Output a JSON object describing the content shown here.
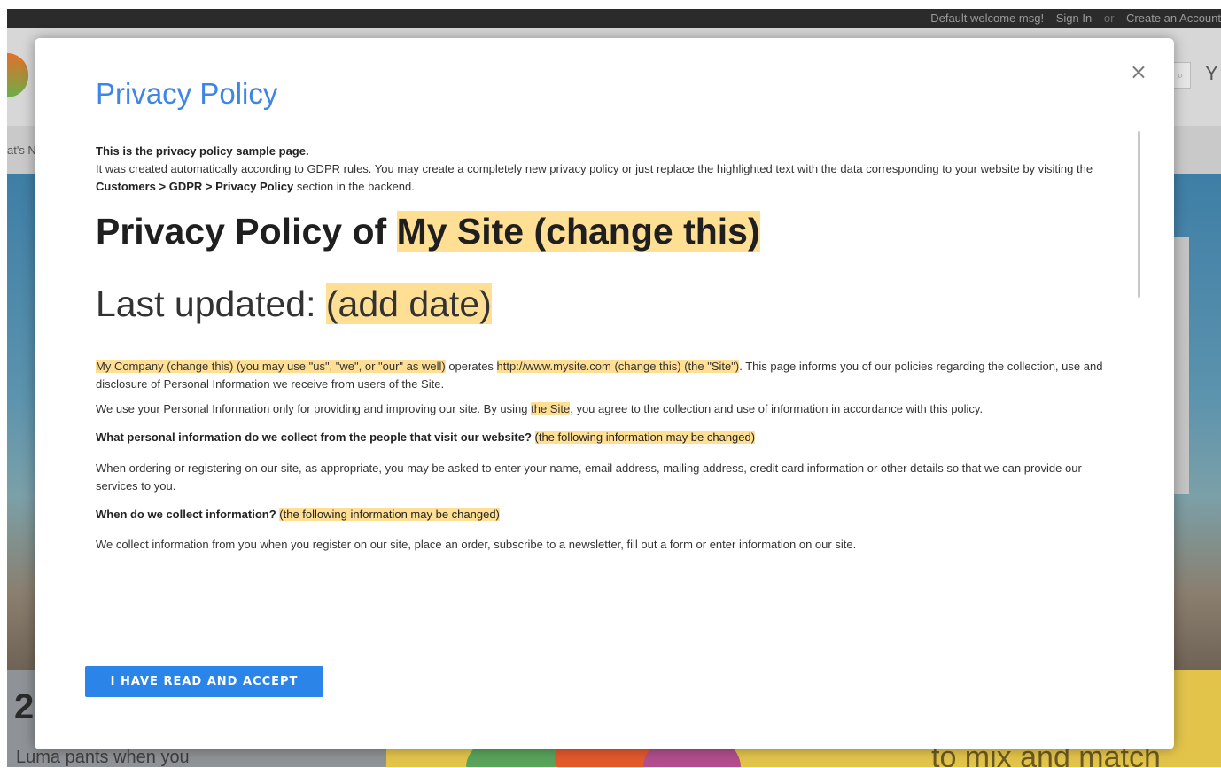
{
  "background_page": {
    "header_links": [
      "Default welcome msg!",
      "Sign In",
      "or",
      "Create an Account"
    ],
    "nav_partial": "at's N",
    "promo_left_big": "2",
    "promo_left_small": "Luma pants when you",
    "promo_right_text": "to mix and match"
  },
  "modal": {
    "title": "Privacy Policy",
    "close_icon": "×",
    "intro_bold": "This is the privacy policy sample page.",
    "intro_text_1": "It was created automatically according to GDPR rules. You may create a completely new privacy policy or just replace the highlighted text with the data corresponding to your website by visiting the ",
    "intro_text_path": "Customers > GDPR > Privacy Policy",
    "intro_text_2": " section in the backend.",
    "heading_prefix": "Privacy Policy of ",
    "heading_highlight": "My Site (change this)",
    "updated_prefix": "Last updated: ",
    "updated_highlight": "(add date)",
    "p1_hl1": "My Company (change this) (you may use \"us\", \"we\", or \"our\" as well)",
    "p1_mid": " operates ",
    "p1_hl2": "http://www.mysite.com (change this) (the \"Site\")",
    "p1_end": ". This page informs you of our policies regarding the collection, use and disclosure of Personal Information we receive from users of the Site.",
    "p2_start": "We use your Personal Information only for providing and improving our site. By using ",
    "p2_hl": "the Site",
    "p2_end": ", you agree to the collection and use of information in accordance with this policy.",
    "q1": "What personal information do we collect from the people that visit our website? ",
    "q1_hl": "(the following information may be changed)",
    "p3": "When ordering or registering on our site, as appropriate, you may be asked to enter your name, email address, mailing address, credit card information or other details so that we can provide our services to you.",
    "q2": "When do we collect information? ",
    "q2_hl": "(the following information may be changed)",
    "p4": "We collect information from you when you register on our site, place an order, subscribe to a newsletter, fill out a form or enter information on our site.",
    "accept_label": "I HAVE READ AND ACCEPT"
  },
  "colors": {
    "accent": "#2b84e8",
    "title": "#3d85e6",
    "highlight": "#ffdf94"
  },
  "icons": {
    "close": "close-icon",
    "search": "search-icon",
    "cart": "cart-icon"
  }
}
